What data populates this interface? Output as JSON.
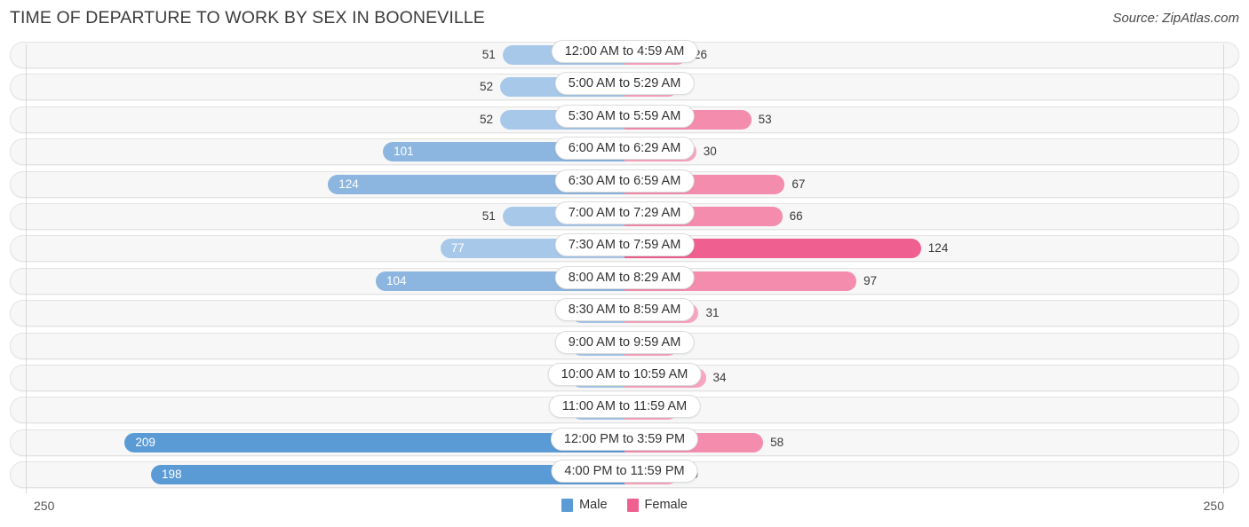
{
  "header": {
    "title": "TIME OF DEPARTURE TO WORK BY SEX IN BOONEVILLE",
    "source": "Source: ZipAtlas.com"
  },
  "axis": {
    "left_label": "250",
    "right_label": "250",
    "max": 250
  },
  "legend": {
    "items": [
      {
        "label": "Male",
        "color": "#5b9bd5"
      },
      {
        "label": "Female",
        "color": "#ef5f90"
      }
    ]
  },
  "colors": {
    "male_light": "#a8c8ea",
    "male_mid": "#8cb6e0",
    "male_dark": "#5b9bd5",
    "female_light": "#f9a5c0",
    "female_mid": "#f48cae",
    "female_dark": "#ef5f90",
    "track_bg": "#f7f7f7",
    "track_border": "#e3e3e3",
    "gridline": "#d8d8d8"
  },
  "chart_data": {
    "type": "bar",
    "title": "TIME OF DEPARTURE TO WORK BY SEX IN BOONEVILLE",
    "subtitle": "",
    "xlabel": "",
    "ylabel": "",
    "orientation": "horizontal",
    "layout": "diverging-bidirectional",
    "xlim": [
      0,
      250
    ],
    "grid": false,
    "legend_position": "bottom-center",
    "categories": [
      "12:00 AM to 4:59 AM",
      "5:00 AM to 5:29 AM",
      "5:30 AM to 5:59 AM",
      "6:00 AM to 6:29 AM",
      "6:30 AM to 6:59 AM",
      "7:00 AM to 7:29 AM",
      "7:30 AM to 7:59 AM",
      "8:00 AM to 8:29 AM",
      "8:30 AM to 8:59 AM",
      "9:00 AM to 9:59 AM",
      "10:00 AM to 10:59 AM",
      "11:00 AM to 11:59 AM",
      "12:00 PM to 3:59 PM",
      "4:00 PM to 11:59 PM"
    ],
    "series": [
      {
        "name": "Male",
        "color": "#5b9bd5",
        "side": "left",
        "values": [
          51,
          52,
          52,
          101,
          124,
          51,
          77,
          104,
          0,
          0,
          11,
          0,
          209,
          198
        ]
      },
      {
        "name": "Female",
        "color": "#ef5f90",
        "side": "right",
        "values": [
          26,
          0,
          53,
          30,
          67,
          66,
          124,
          97,
          31,
          6,
          34,
          6,
          58,
          19
        ]
      }
    ]
  },
  "rows": [
    {
      "label": "12:00 AM to 4:59 AM",
      "male": 51,
      "female": 26,
      "male_text": "51",
      "female_text": "26"
    },
    {
      "label": "5:00 AM to 5:29 AM",
      "male": 52,
      "female": 0,
      "male_text": "52",
      "female_text": "0"
    },
    {
      "label": "5:30 AM to 5:59 AM",
      "male": 52,
      "female": 53,
      "male_text": "52",
      "female_text": "53"
    },
    {
      "label": "6:00 AM to 6:29 AM",
      "male": 101,
      "female": 30,
      "male_text": "101",
      "female_text": "30"
    },
    {
      "label": "6:30 AM to 6:59 AM",
      "male": 124,
      "female": 67,
      "male_text": "124",
      "female_text": "67"
    },
    {
      "label": "7:00 AM to 7:29 AM",
      "male": 51,
      "female": 66,
      "male_text": "51",
      "female_text": "66"
    },
    {
      "label": "7:30 AM to 7:59 AM",
      "male": 77,
      "female": 124,
      "male_text": "77",
      "female_text": "124"
    },
    {
      "label": "8:00 AM to 8:29 AM",
      "male": 104,
      "female": 97,
      "male_text": "104",
      "female_text": "97"
    },
    {
      "label": "8:30 AM to 8:59 AM",
      "male": 0,
      "female": 31,
      "male_text": "0",
      "female_text": "31"
    },
    {
      "label": "9:00 AM to 9:59 AM",
      "male": 0,
      "female": 6,
      "male_text": "0",
      "female_text": "6"
    },
    {
      "label": "10:00 AM to 10:59 AM",
      "male": 11,
      "female": 34,
      "male_text": "11",
      "female_text": "34"
    },
    {
      "label": "11:00 AM to 11:59 AM",
      "male": 0,
      "female": 6,
      "male_text": "0",
      "female_text": "6"
    },
    {
      "label": "12:00 PM to 3:59 PM",
      "male": 209,
      "female": 58,
      "male_text": "209",
      "female_text": "58"
    },
    {
      "label": "4:00 PM to 11:59 PM",
      "male": 198,
      "female": 19,
      "male_text": "198",
      "female_text": "19"
    }
  ]
}
